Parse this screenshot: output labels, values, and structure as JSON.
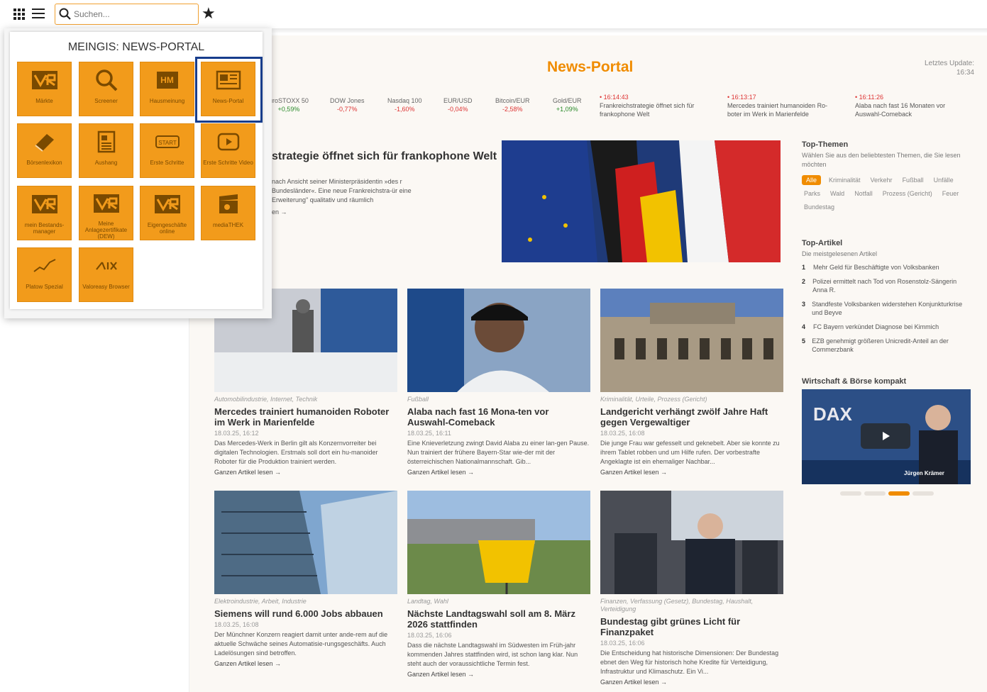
{
  "toolbar": {
    "search_placeholder": "Suchen...",
    "icons": [
      "apps-grid-icon",
      "menu-icon",
      "search-icon",
      "star-icon"
    ]
  },
  "launcher": {
    "title": "MEINGIS: NEWS-PORTAL",
    "tiles": [
      {
        "label": "Märkte",
        "icon": "vr-logo-icon"
      },
      {
        "label": "Screener",
        "icon": "magnifier-icon"
      },
      {
        "label": "Hausmeinung",
        "icon": "hm-icon"
      },
      {
        "label": "News-Portal",
        "icon": "newspaper-icon",
        "selected": true
      },
      {
        "label": "Börsenlexikon",
        "icon": "book-icon"
      },
      {
        "label": "Aushang",
        "icon": "document-icon"
      },
      {
        "label": "Erste Schritte",
        "icon": "start-icon"
      },
      {
        "label": "Erste Schritte Video",
        "icon": "video-icon"
      },
      {
        "label": "mein Bestands-manager",
        "icon": "vr-logo-icon"
      },
      {
        "label": "Meine Anlagezertifikate (DEW)",
        "icon": "vr-logo-icon"
      },
      {
        "label": "Eigengeschäfte online",
        "icon": "vr-logo-icon"
      },
      {
        "label": "mediaTHEK",
        "icon": "clapperboard-icon"
      },
      {
        "label": "Platow Spezial",
        "icon": "chart-line-icon"
      },
      {
        "label": "Valoreasy Browser",
        "icon": "six-logo-icon"
      }
    ],
    "tile_color": "#f29b1b",
    "selection_color": "#173d8c"
  },
  "portal": {
    "title": "News-Portal",
    "update_label": "Letztes Update:",
    "update_time": "16:34",
    "accent": "#f08c00"
  },
  "ticker": [
    {
      "name": "uroSTOXX 50",
      "value": "+0,59%",
      "positive": true
    },
    {
      "name": "DOW Jones",
      "value": "-0,77%",
      "positive": false
    },
    {
      "name": "Nasdaq 100",
      "value": "-1,60%",
      "positive": false
    },
    {
      "name": "EUR/USD",
      "value": "-0,04%",
      "positive": false
    },
    {
      "name": "Bitcoin/EUR",
      "value": "-2,58%",
      "positive": false
    },
    {
      "name": "Gold/EUR",
      "value": "+1,09%",
      "positive": true
    }
  ],
  "flash": [
    {
      "time": "• 16:14:43",
      "text": "Frankreichstrategie öffnet sich für frankophone Welt"
    },
    {
      "time": "• 16:13:17",
      "text": "Mercedes trainiert humanoiden Ro-boter im Werk in Marienfelde"
    },
    {
      "time": "• 16:11:26",
      "text": "Alaba nach fast 16 Monaten vor Auswahl-Comeback"
    }
  ],
  "hero": {
    "title": "strategie öffnet sich für frankophone Welt",
    "text": "nach Ansicht seiner Ministerpräsidentin »des r Bundesländer«. Eine neue Frankreichstra-ür eine Erweiterung\" qualitativ und räumlich",
    "more": "en →"
  },
  "articles": [
    {
      "category": "Automobilindustrie, Internet, Technik",
      "title": "Mercedes trainiert humanoiden Roboter im Werk in Marienfelde",
      "date": "18.03.25, 16:12",
      "teaser": "Das Mercedes-Werk in Berlin gilt als Konzernvorreiter bei digitalen Technologien. Erstmals soll dort ein hu-manoider Roboter für die Produktion trainiert werden.",
      "more": "Ganzen Artikel lesen →"
    },
    {
      "category": "Fußball",
      "title": "Alaba nach fast 16 Mona-ten vor Auswahl-Comeback",
      "date": "18.03.25, 16:11",
      "teaser": "Eine Knieverletzung zwingt David Alaba zu einer lan-gen Pause. Nun trainiert der frühere Bayern-Star wie-der mit der österreichischen Nationalmannschaft. Gib...",
      "more": "Ganzen Artikel lesen →"
    },
    {
      "category": "Kriminalität, Urteile, Prozess (Gericht)",
      "title": "Landgericht verhängt zwölf Jahre Haft gegen Vergewaltiger",
      "date": "18.03.25, 16:08",
      "teaser": "Die junge Frau war gefesselt und geknebelt. Aber sie konnte zu ihrem Tablet robben und um Hilfe rufen. Der vorbestrafte Angeklagte ist ein ehemaliger Nachbar...",
      "more": "Ganzen Artikel lesen →"
    },
    {
      "category": "Elektroindustrie, Arbeit, Industrie",
      "title": "Siemens will rund 6.000 Jobs abbauen",
      "date": "18.03.25, 16:08",
      "teaser": "Der Münchner Konzern reagiert damit unter ande-rem auf die aktuelle Schwäche seines Automatisie-rungsgeschäfts. Auch Ladelösungen sind betroffen.",
      "more": "Ganzen Artikel lesen →"
    },
    {
      "category": "Landtag, Wahl",
      "title": "Nächste Landtagswahl soll am 8. März 2026 stattfinden",
      "date": "18.03.25, 16:06",
      "teaser": "Dass die nächste Landtagswahl im Südwesten im Früh-jahr kommenden Jahres stattfinden wird, ist schon lang klar. Nun steht auch der voraussichtliche Termin fest.",
      "more": "Ganzen Artikel lesen →"
    },
    {
      "category": "Finanzen, Verfassung (Gesetz), Bundestag, Haushalt, Verteidigung",
      "title": "Bundestag gibt grünes Licht für Finanzpaket",
      "date": "18.03.25, 16:06",
      "teaser": "Die Entscheidung hat historische Dimensionen: Der Bundestag ebnet den Weg für historisch hohe Kredite für Verteidigung, Infrastruktur und Klimaschutz. Ein Vi...",
      "more": "Ganzen Artikel lesen →"
    }
  ],
  "sidebar": {
    "topics_title": "Top-Themen",
    "topics_sub": "Wählen Sie aus den beliebtesten Themen, die Sie lesen möchten",
    "tags": [
      "Alle",
      "Kriminalität",
      "Verkehr",
      "Fußball",
      "Unfälle",
      "Parks",
      "Wald",
      "Notfall",
      "Prozess (Gericht)",
      "Feuer",
      "Bundestag"
    ],
    "articles_title": "Top-Artikel",
    "articles_sub": "Die meistgelesenen Artikel",
    "top_articles": [
      {
        "n": "1",
        "text": "Mehr Geld für Beschäftigte von Volksbanken"
      },
      {
        "n": "2",
        "text": "Polizei ermittelt nach Tod von Rosenstolz-Sängerin Anna R."
      },
      {
        "n": "3",
        "text": "Standfeste Volksbanken widerstehen Konjunkturkrise und Beyve"
      },
      {
        "n": "4",
        "text": "FC Bayern verkündet Diagnose bei Kimmich"
      },
      {
        "n": "5",
        "text": "EZB genehmigt größeren Unicredit-Anteil an der Commerzbank"
      }
    ],
    "video_title": "Wirtschaft & Börse kompakt",
    "video_badge": "DAX",
    "video_person": "Jürgen Krämer"
  }
}
